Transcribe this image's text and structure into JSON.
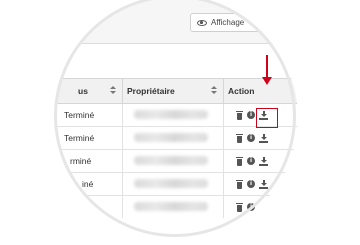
{
  "toolbar": {
    "view_button_label": "Affichage",
    "view_button_icon": "eye-icon"
  },
  "table": {
    "columns": [
      {
        "label": "us"
      },
      {
        "label": "Propriétaire"
      },
      {
        "label": "Action"
      }
    ],
    "rows": [
      {
        "status": "Terminé"
      },
      {
        "status": "Terminé"
      },
      {
        "status": "rminé"
      },
      {
        "status": "iné"
      },
      {
        "status": ""
      }
    ],
    "row_action_icons": [
      "trash-icon",
      "info-icon",
      "download-icon"
    ]
  },
  "annotation": {
    "color": "#d0021b",
    "target": "download-icon"
  }
}
